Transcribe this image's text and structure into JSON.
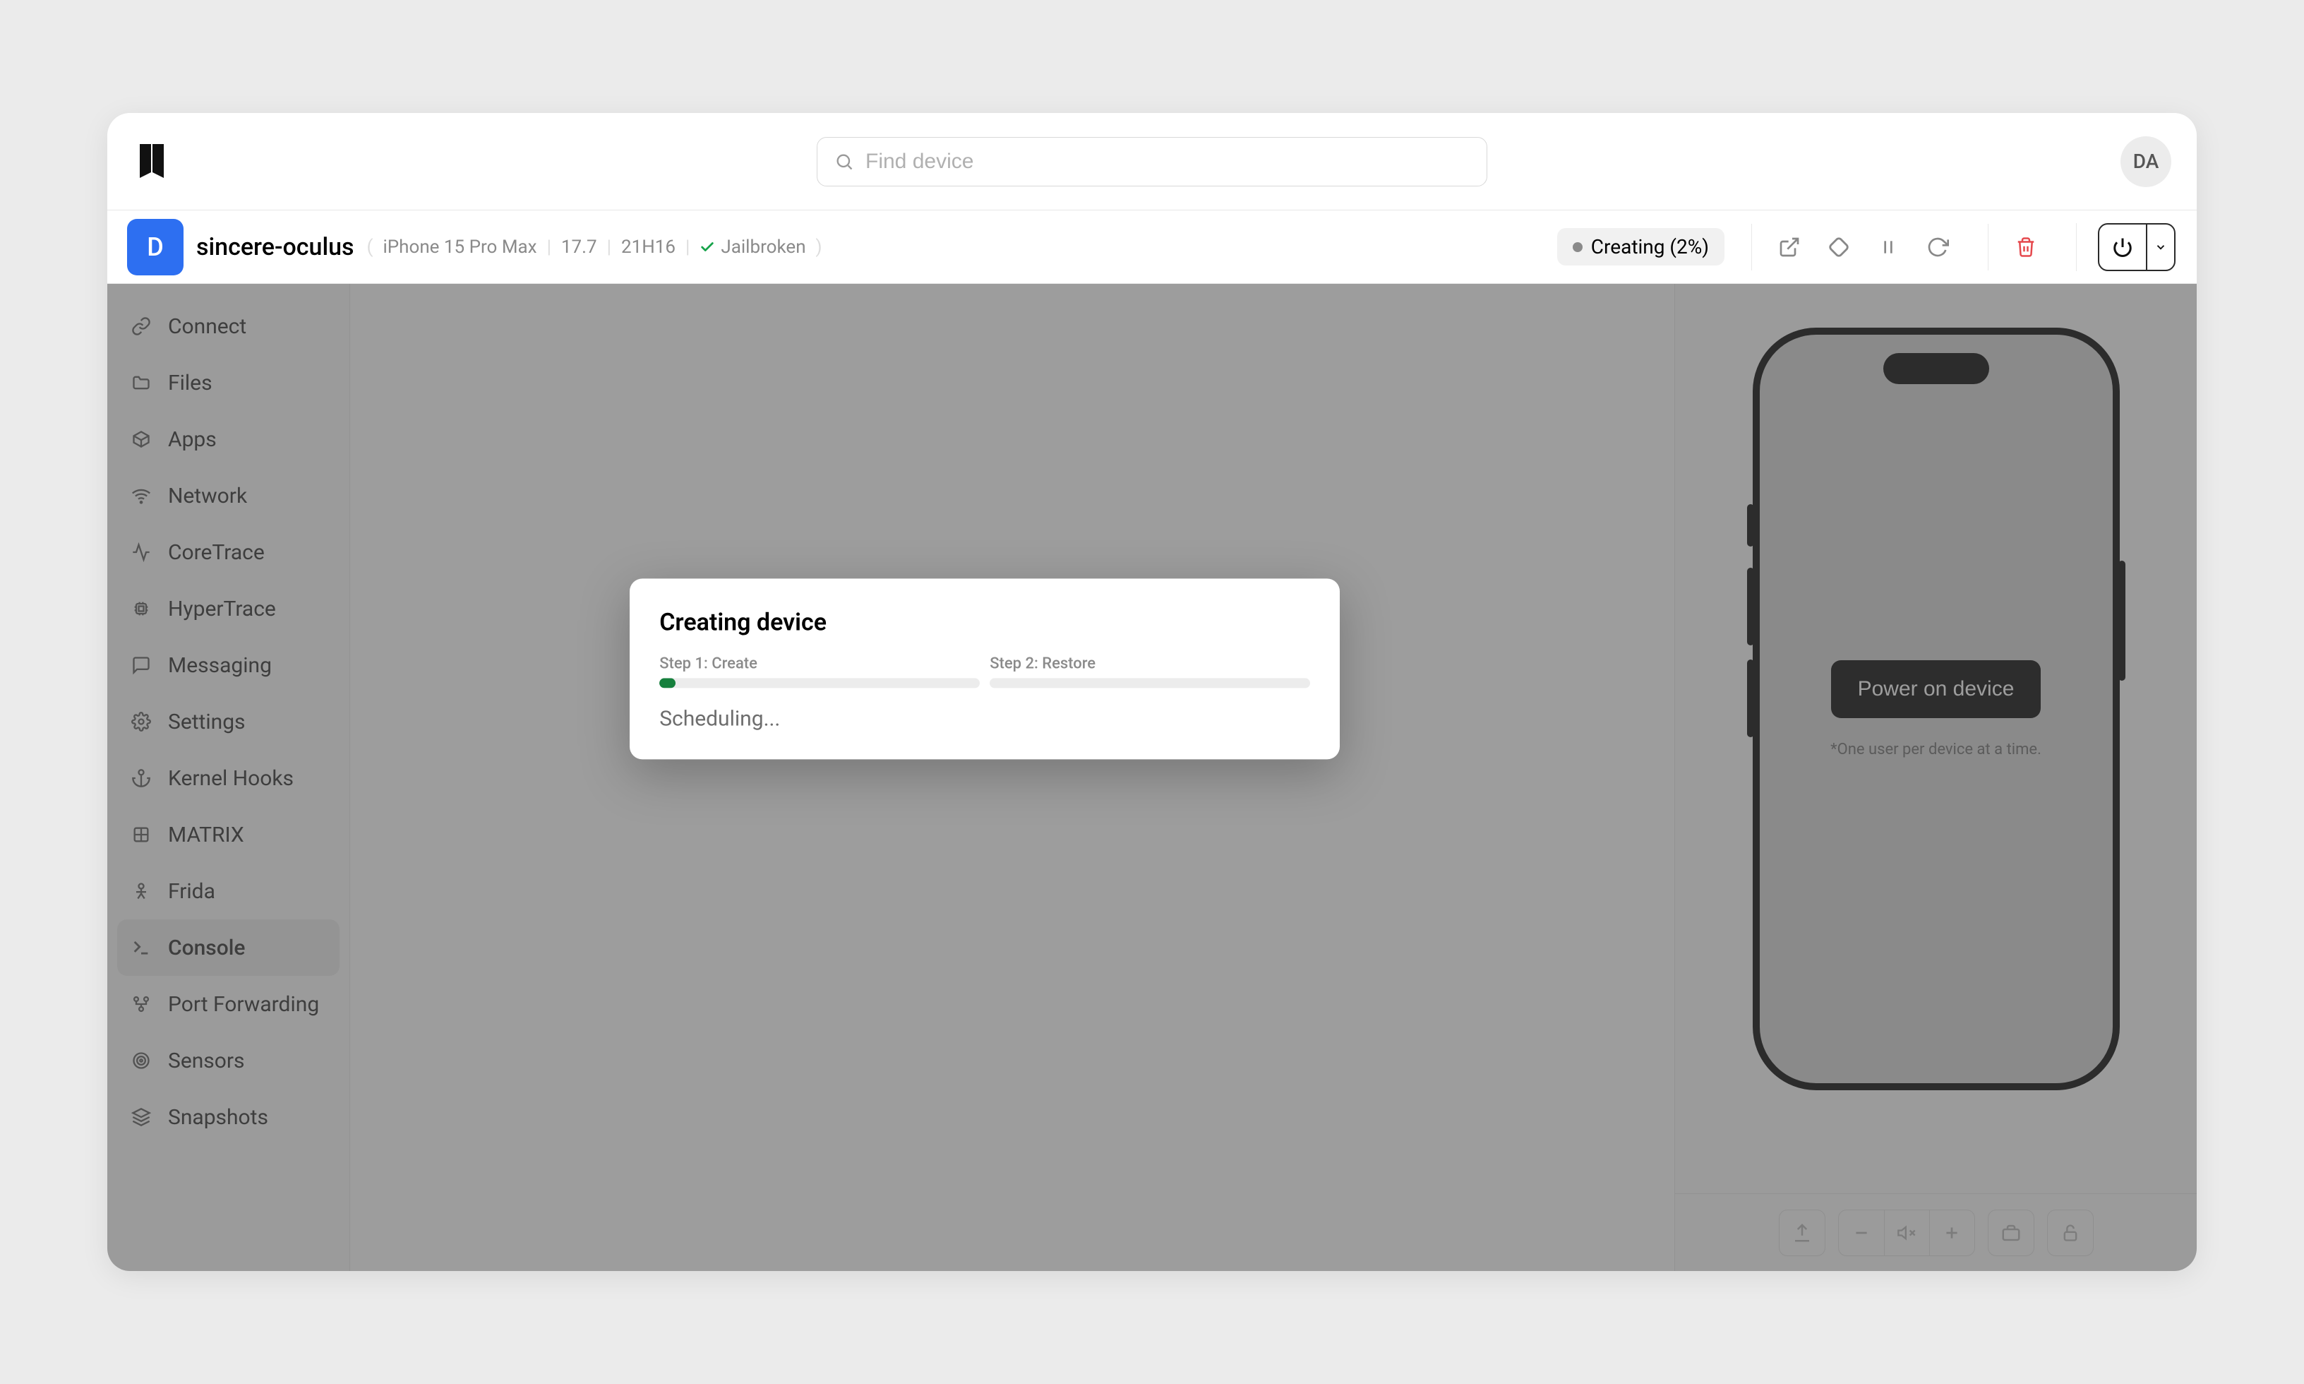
{
  "topbar": {
    "search_placeholder": "Find device",
    "avatar_initials": "DA"
  },
  "device": {
    "project_initial": "D",
    "name": "sincere-oculus",
    "model": "iPhone 15 Pro Max",
    "os_version": "17.7",
    "build": "21H16",
    "jailbroken_label": "Jailbroken",
    "status_label": "Creating (2%)"
  },
  "sidebar": {
    "items": [
      {
        "label": "Connect",
        "icon": "link-icon"
      },
      {
        "label": "Files",
        "icon": "folder-icon"
      },
      {
        "label": "Apps",
        "icon": "cube-icon"
      },
      {
        "label": "Network",
        "icon": "wifi-icon"
      },
      {
        "label": "CoreTrace",
        "icon": "pulse-icon"
      },
      {
        "label": "HyperTrace",
        "icon": "chip-icon"
      },
      {
        "label": "Messaging",
        "icon": "message-icon"
      },
      {
        "label": "Settings",
        "icon": "gear-icon"
      },
      {
        "label": "Kernel Hooks",
        "icon": "anchor-icon"
      },
      {
        "label": "MATRIX",
        "icon": "grid-icon"
      },
      {
        "label": "Frida",
        "icon": "frida-icon"
      },
      {
        "label": "Console",
        "icon": "terminal-icon",
        "active": true
      },
      {
        "label": "Port Forwarding",
        "icon": "ports-icon"
      },
      {
        "label": "Sensors",
        "icon": "radar-icon"
      },
      {
        "label": "Snapshots",
        "icon": "layers-icon"
      }
    ]
  },
  "right_panel": {
    "power_button_label": "Power on device",
    "note": "*One user per device at a time."
  },
  "modal": {
    "title": "Creating device",
    "step1_label": "Step 1: Create",
    "step1_progress_pct": 5,
    "step2_label": "Step 2: Restore",
    "step2_progress_pct": 0,
    "status_text": "Scheduling..."
  }
}
